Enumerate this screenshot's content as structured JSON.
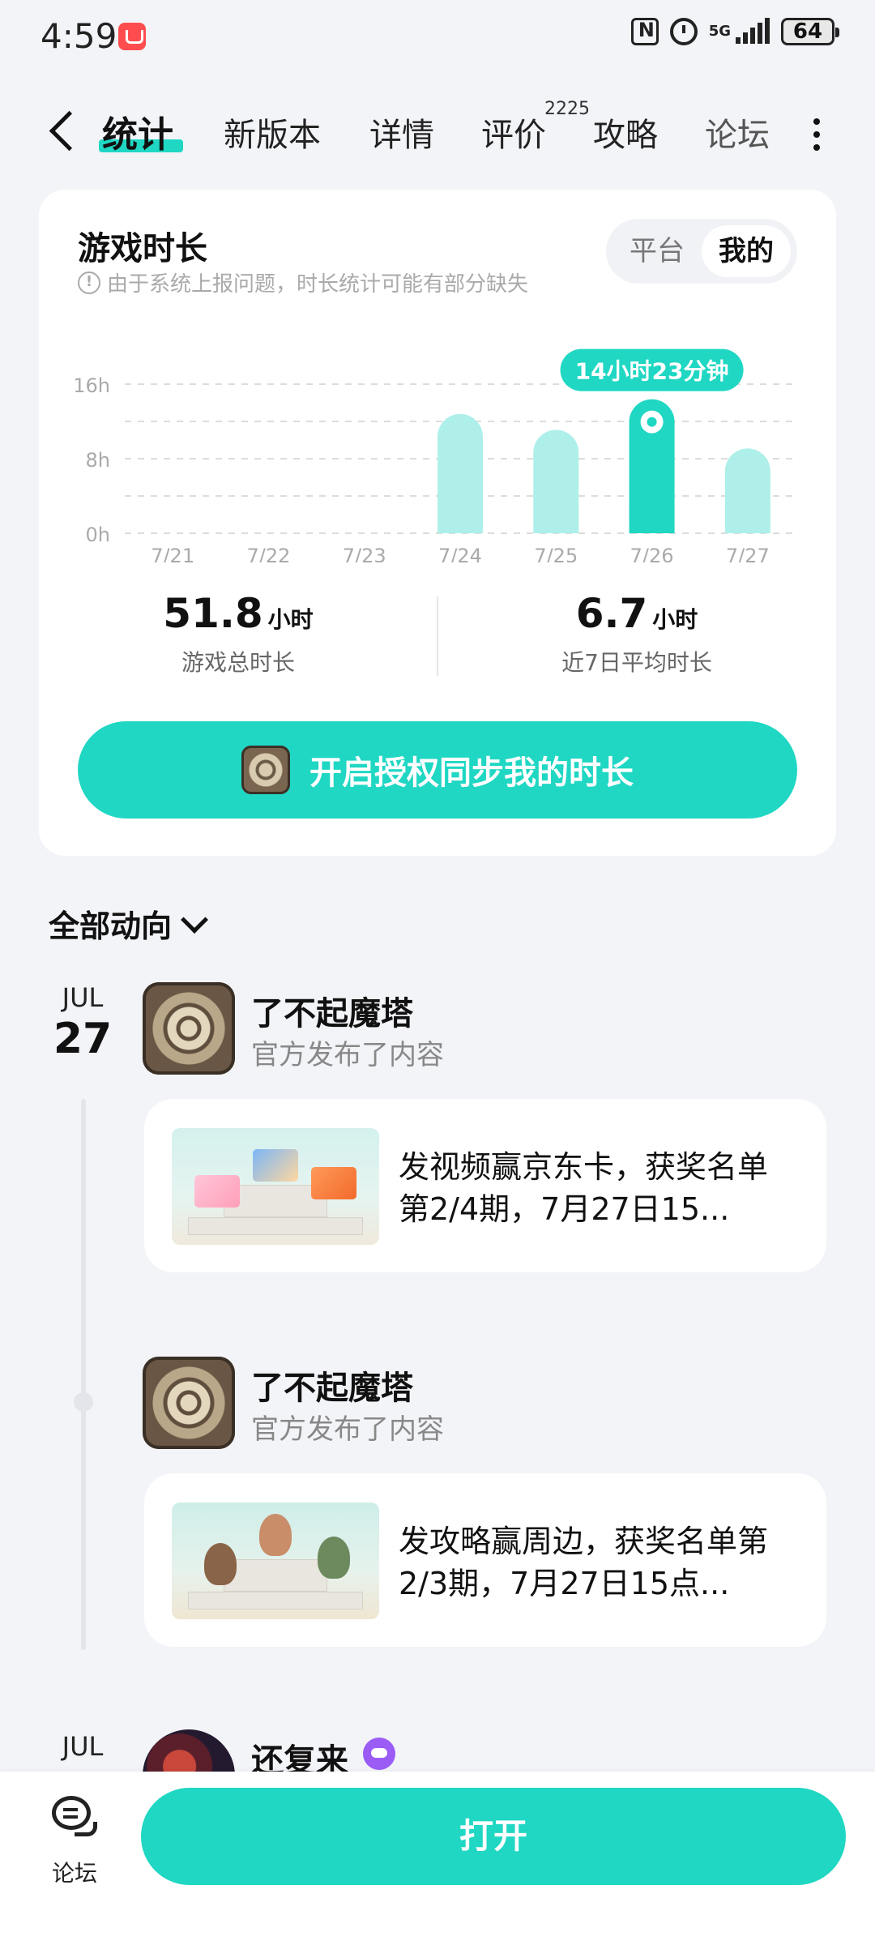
{
  "status_bar": {
    "time": "4:59",
    "network": "5G",
    "battery": "64"
  },
  "tabs": [
    {
      "label": "统计",
      "active": true
    },
    {
      "label": "新版本"
    },
    {
      "label": "详情"
    },
    {
      "label": "评价",
      "badge": "2225"
    },
    {
      "label": "攻略"
    },
    {
      "label": "论坛"
    }
  ],
  "stats_card": {
    "title": "游戏时长",
    "note": "由于系统上报问题，时长统计可能有部分缺失",
    "segment": {
      "left": "平台",
      "right": "我的",
      "selected": "我的"
    },
    "total": {
      "value": "51.8",
      "unit": "小时",
      "label": "游戏总时长"
    },
    "average": {
      "value": "6.7",
      "unit": "小时",
      "label": "近7日平均时长"
    },
    "auth_button": "开启授权同步我的时长"
  },
  "chart_data": {
    "type": "bar",
    "categories": [
      "7/21",
      "7/22",
      "7/23",
      "7/24",
      "7/25",
      "7/26",
      "7/27"
    ],
    "values": [
      0,
      0,
      0,
      12.8,
      11.1,
      14.38,
      9.1
    ],
    "ylim": [
      0,
      16
    ],
    "yticks": [
      "16h",
      "8h",
      "0h"
    ],
    "highlight_index": 5,
    "highlight_label": "14小时23分钟",
    "colors": {
      "bar": "#aef0e9",
      "highlight": "#1fd7c3"
    },
    "grid": true
  },
  "feed": {
    "filter_label": "全部动向",
    "entries": [
      {
        "month": "JUL",
        "day": "27",
        "game": "了不起魔塔",
        "action": "官方发布了内容",
        "post_title": "发视频赢京东卡，获奖名单 第2/4期，7月27日15..."
      },
      {
        "game": "了不起魔塔",
        "action": "官方发布了内容",
        "post_title": "发攻略赢周边，获奖名单第2/3期，7月27日15点..."
      },
      {
        "month": "JUL",
        "game": "还复来"
      }
    ]
  },
  "bottom_bar": {
    "forum_label": "论坛",
    "open_button": "打开"
  }
}
